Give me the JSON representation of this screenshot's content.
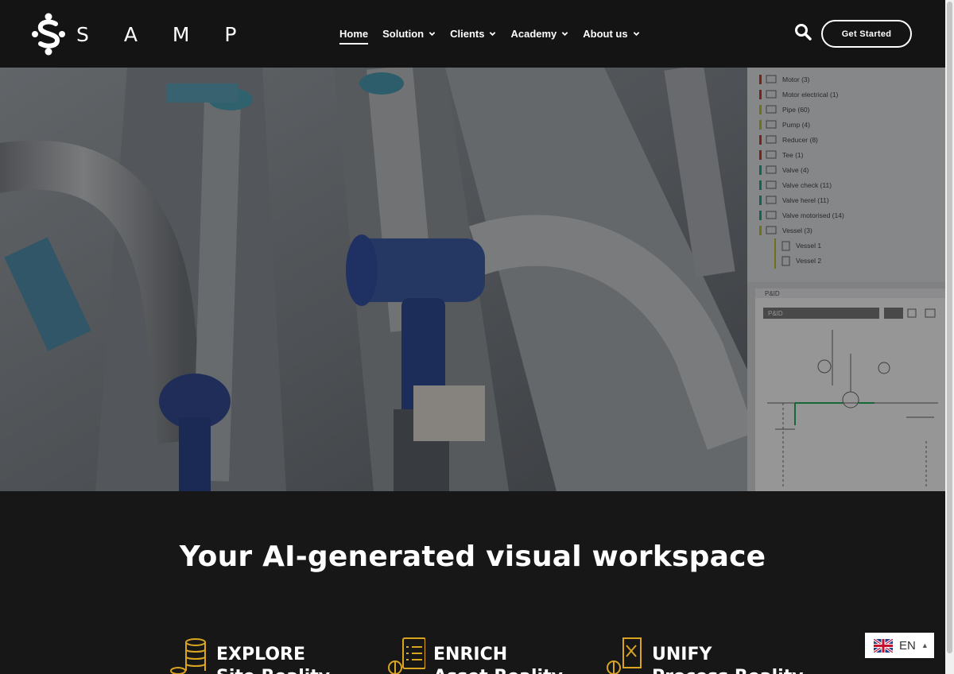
{
  "brand": {
    "name": "S A M P"
  },
  "nav": {
    "items": [
      {
        "label": "Home",
        "active": true,
        "dropdown": false
      },
      {
        "label": "Solution",
        "active": false,
        "dropdown": true
      },
      {
        "label": "Clients",
        "active": false,
        "dropdown": true
      },
      {
        "label": "Academy",
        "active": false,
        "dropdown": true
      },
      {
        "label": "About us",
        "active": false,
        "dropdown": true
      }
    ],
    "search_icon": "search-icon",
    "cta_label": "Get Started"
  },
  "hero": {
    "panel_tree": [
      "Motor (3)",
      "Motor electrical (1)",
      "Pipe (60)",
      "Pump (4)",
      "Reducer (8)",
      "Tee (1)",
      "Valve (4)",
      "Valve check (11)",
      "Valve herel (11)",
      "Valve motorised (14)",
      "Vessel (3)",
      "Vessel 1",
      "Vessel 2"
    ],
    "pid_label": "P&ID",
    "pid_select": "P&ID"
  },
  "section": {
    "title": "Your AI-generated visual workspace",
    "features": [
      {
        "icon": "database-icon",
        "line1": "EXPLORE",
        "line2": "Site Reality"
      },
      {
        "icon": "checklist-icon",
        "line1": "ENRICH",
        "line2": "Asset Reality"
      },
      {
        "icon": "process-document-icon",
        "line1": "UNIFY",
        "line2": "Process Reality"
      }
    ]
  },
  "language": {
    "code": "EN",
    "flag_icon": "uk-flag-icon"
  },
  "colors": {
    "accent_gold": "#d9a521",
    "background": "#171717",
    "header": "#141414"
  }
}
